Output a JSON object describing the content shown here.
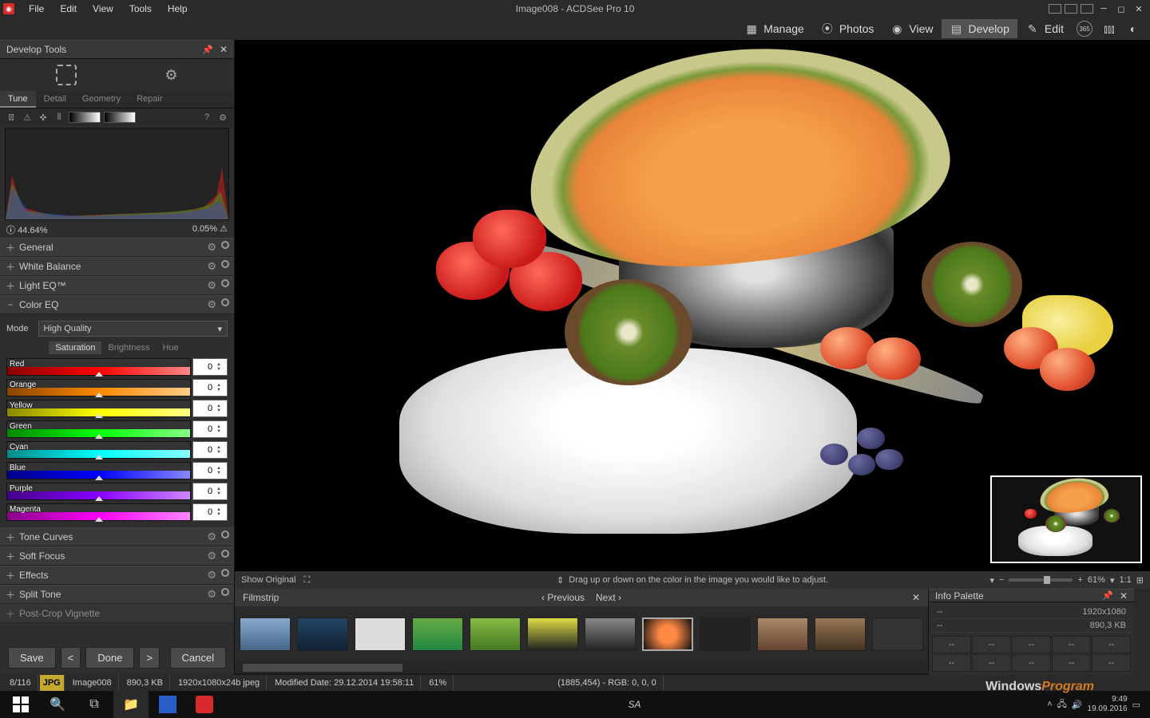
{
  "window": {
    "title": "Image008 - ACDSee Pro 10"
  },
  "menu": {
    "items": [
      "File",
      "Edit",
      "View",
      "Tools",
      "Help"
    ]
  },
  "modes": {
    "manage": "Manage",
    "photos": "Photos",
    "view": "View",
    "develop": "Develop",
    "edit": "Edit"
  },
  "left": {
    "panel_title": "Develop Tools",
    "tabs": [
      "Tune",
      "Detail",
      "Geometry",
      "Repair"
    ],
    "histo_left": "44.64%",
    "histo_right": "0.05%",
    "sections": {
      "general": "General",
      "wb": "White Balance",
      "lighteq": "Light EQ™",
      "coloreq": "Color EQ",
      "tone": "Tone Curves",
      "soft": "Soft Focus",
      "effects": "Effects",
      "split": "Split Tone",
      "vign": "Post-Crop Vignette"
    },
    "coloreq": {
      "mode_label": "Mode",
      "mode_value": "High Quality",
      "subtabs": [
        "Saturation",
        "Brightness",
        "Hue"
      ],
      "sliders": [
        {
          "name": "Red",
          "grad": "linear-gradient(90deg,#800,#f00,#f88)",
          "val": "0"
        },
        {
          "name": "Orange",
          "grad": "linear-gradient(90deg,#840,#f80,#fc8)",
          "val": "0"
        },
        {
          "name": "Yellow",
          "grad": "linear-gradient(90deg,#880,#ff0,#ff8)",
          "val": "0"
        },
        {
          "name": "Green",
          "grad": "linear-gradient(90deg,#080,#0f0,#8f8)",
          "val": "0"
        },
        {
          "name": "Cyan",
          "grad": "linear-gradient(90deg,#088,#0ff,#8ff)",
          "val": "0"
        },
        {
          "name": "Blue",
          "grad": "linear-gradient(90deg,#008,#00f,#88f)",
          "val": "0"
        },
        {
          "name": "Purple",
          "grad": "linear-gradient(90deg,#408,#80f,#c8f)",
          "val": "0"
        },
        {
          "name": "Magenta",
          "grad": "linear-gradient(90deg,#808,#f0f,#f8f)",
          "val": "0"
        }
      ]
    },
    "buttons": {
      "save": "Save",
      "done": "Done",
      "cancel": "Cancel"
    }
  },
  "canvas": {
    "show_original": "Show Original",
    "hint": "Drag up or down on the color in the image you would like to adjust.",
    "zoom": "61%",
    "fit": "1:1"
  },
  "filmstrip": {
    "title": "Filmstrip",
    "prev": "Previous",
    "next": "Next"
  },
  "info": {
    "title": "Info Palette",
    "res": "1920x1080",
    "size": "890,3 KB",
    "novalue": "--"
  },
  "status": {
    "count": "8/116",
    "format": "JPG",
    "name": "Image008",
    "size": "890,3 KB",
    "dims": "1920x1080x24b jpeg",
    "modified": "Modified Date: 29.12.2014 19:58:11",
    "zoom": "61%",
    "pixel": "(1885,454) - RGB: 0, 0, 0"
  },
  "taskbar": {
    "time": "9:49",
    "date": "19.09.2016",
    "lang": "SA"
  },
  "watermark": {
    "a": "Windows",
    "b": "Program"
  }
}
